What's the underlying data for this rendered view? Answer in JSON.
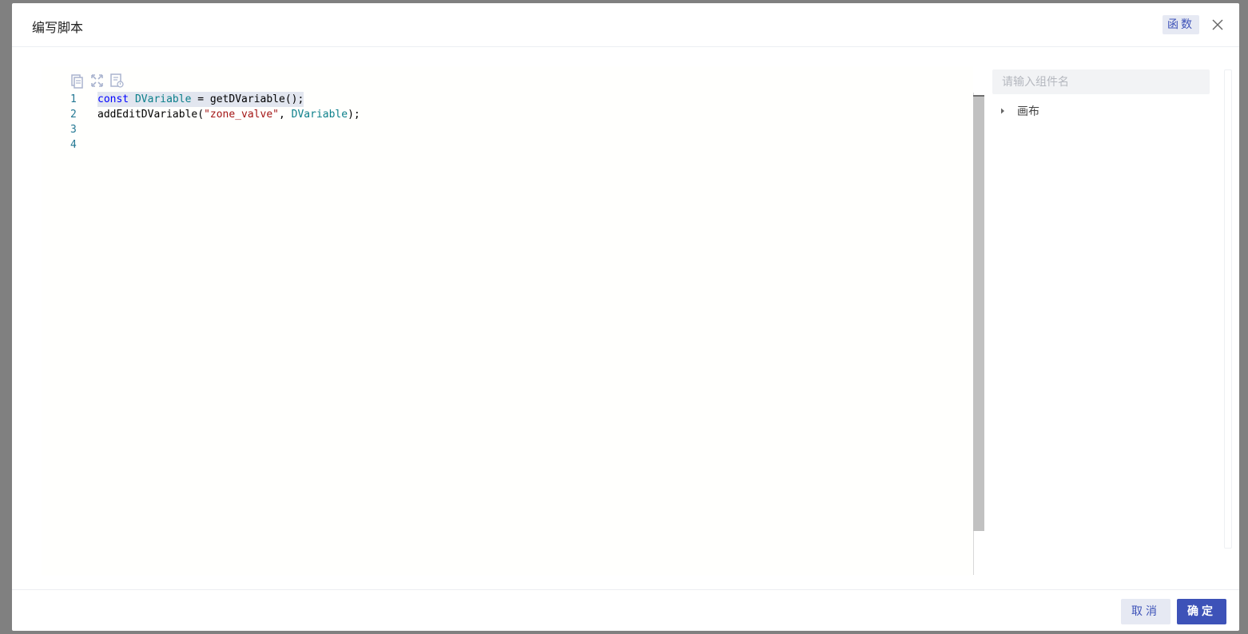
{
  "dialog": {
    "title": "编写脚本",
    "function_button": "函数",
    "close_icon": "close-icon"
  },
  "editor": {
    "toolbar_icons": [
      "copy-icon",
      "expand-icon",
      "format-icon"
    ],
    "lines": [
      {
        "number": "1",
        "tokens": [
          {
            "text": "const",
            "kind": "kw"
          },
          {
            "text": " ",
            "kind": "plain"
          },
          {
            "text": "DVariable",
            "kind": "var"
          },
          {
            "text": " = getDVariable();",
            "kind": "plain"
          }
        ]
      },
      {
        "number": "2",
        "tokens": [
          {
            "text": "addEditDVariable(",
            "kind": "plain"
          },
          {
            "text": "\"zone_valve\"",
            "kind": "str"
          },
          {
            "text": ", ",
            "kind": "plain"
          },
          {
            "text": "DVariable",
            "kind": "var"
          },
          {
            "text": ");",
            "kind": "plain"
          }
        ]
      },
      {
        "number": "3",
        "tokens": []
      },
      {
        "number": "4",
        "tokens": []
      }
    ]
  },
  "component_panel": {
    "search_placeholder": "请输入组件名",
    "search_value": "",
    "tree": [
      {
        "label": "画布",
        "expanded": false
      }
    ]
  },
  "footer": {
    "cancel_label": "取消",
    "ok_label": "确定"
  },
  "colors": {
    "primary": "#3d52b8",
    "secondary_bg": "#e6e9f3",
    "keyword": "#0000ff",
    "variable": "#0b7f8a",
    "string": "#a31515",
    "line_number": "#237893"
  }
}
